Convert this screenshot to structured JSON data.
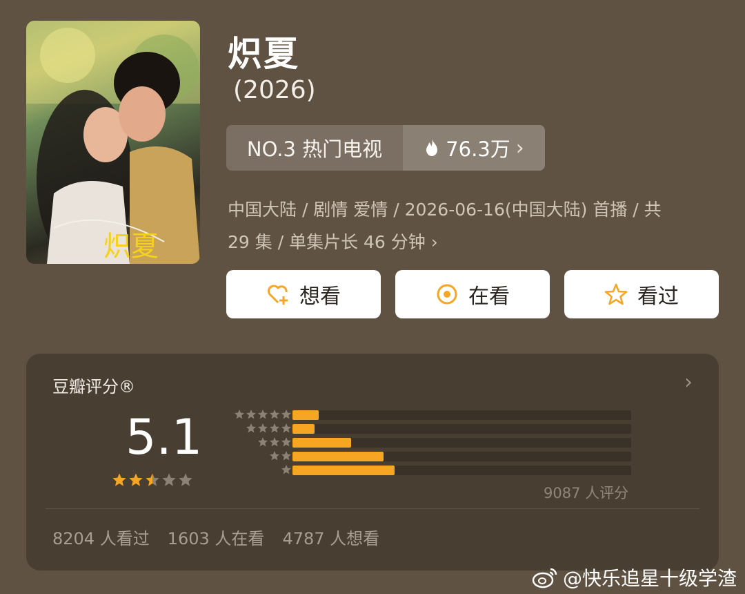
{
  "show": {
    "title": "炽夏",
    "year": "(2026)",
    "rank": "NO.3 热门电视",
    "heat": "76.3万",
    "meta_line1": "中国大陆 / 剧情 爱情 / 2026-06-16(中国大陆) 首播 / 共",
    "meta_line2": "29 集 / 单集片长 46 分钟"
  },
  "poster": {
    "calligraphy": "炽夏"
  },
  "actions": {
    "want_label": "想看",
    "watching_label": "在看",
    "watched_label": "看过"
  },
  "rating": {
    "header": "豆瓣评分®",
    "score": "5.1",
    "score_stars": 2.5,
    "raters": "9087 人评分",
    "distribution": [
      {
        "stars": 5,
        "fraction": 0.077
      },
      {
        "stars": 4,
        "fraction": 0.065
      },
      {
        "stars": 3,
        "fraction": 0.173
      },
      {
        "stars": 2,
        "fraction": 0.268
      },
      {
        "stars": 1,
        "fraction": 0.301
      }
    ],
    "watched_count": "8204 人看过",
    "watching_count": "1603 人在看",
    "want_count": "4787 人想看"
  },
  "watermark": "@快乐追星十级学渣",
  "icons": {
    "heat": "flame-icon",
    "want": "heart-plus-icon",
    "watching": "target-icon",
    "watched": "star-outline-icon",
    "more": "chevron-right-icon",
    "weibo": "weibo-logo-icon"
  },
  "colors": {
    "accent": "#f6a623",
    "background": "#5f5242",
    "card": "#493e32"
  }
}
